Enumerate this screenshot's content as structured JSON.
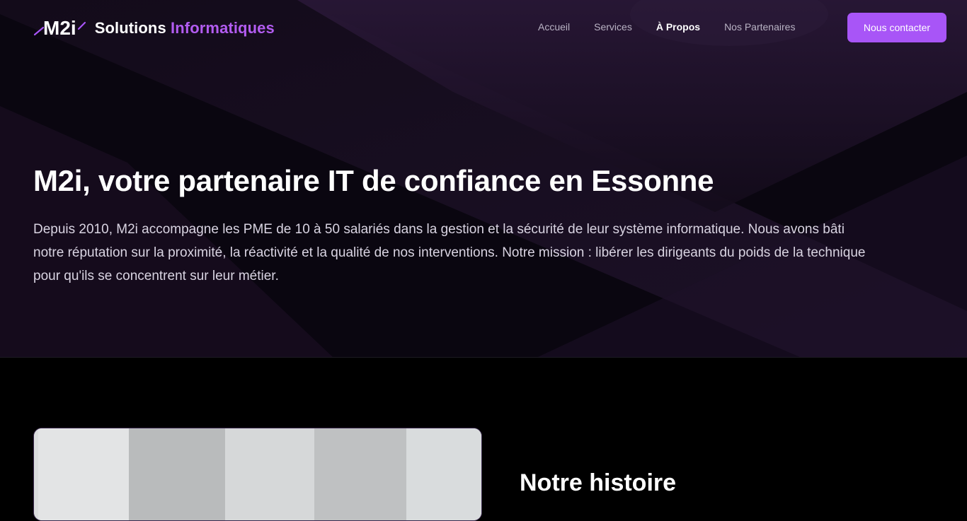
{
  "logo": {
    "mark": "M2i",
    "name_white": "Solutions",
    "name_accent": "Informatiques"
  },
  "nav": {
    "items": [
      {
        "label": "Accueil",
        "active": false
      },
      {
        "label": "Services",
        "active": false
      },
      {
        "label": "À Propos",
        "active": true
      },
      {
        "label": "Nos Partenaires",
        "active": false
      }
    ],
    "cta_label": "Nous contacter"
  },
  "hero": {
    "title": "M2i, votre partenaire IT de confiance en Essonne",
    "text": "Depuis 2010, M2i accompagne les PME de 10 à 50 salariés dans la gestion et la sécurité de leur système informatique. Nous avons bâti notre réputation sur la proximité, la réactivité et la qualité de nos interventions. Notre mission : libérer les dirigeants du poids de la technique pour qu'ils se concentrent sur leur métier."
  },
  "history": {
    "title": "Notre histoire"
  },
  "colors": {
    "accent": "#a855f7",
    "accent_text": "#b25cf0",
    "background": "#000000"
  }
}
